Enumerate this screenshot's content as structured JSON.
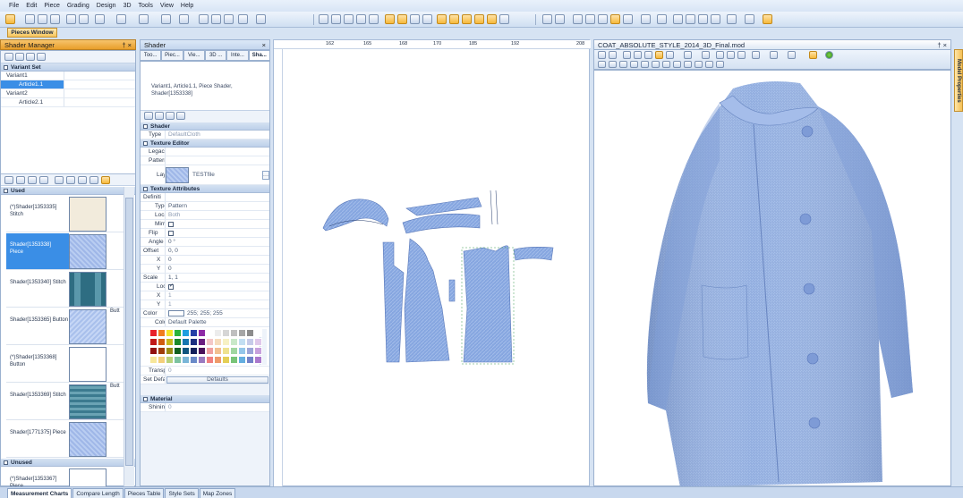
{
  "menu": [
    "File",
    "Edit",
    "Piece",
    "Grading",
    "Design",
    "3D",
    "Tools",
    "View",
    "Help"
  ],
  "pieces_window_label": "Pieces Window",
  "shader_manager": {
    "title": "Shader Manager",
    "pin": "†",
    "close": "×",
    "variant_set_label": "Variant Set",
    "variants": [
      {
        "label": "Variant1",
        "article": "Article1.1"
      },
      {
        "label": "Variant2",
        "article": "Article2.1"
      }
    ],
    "used_label": "Used",
    "unused_label": "Unused",
    "shaders": [
      {
        "label": "(*)Shader[1353335] Stitch",
        "swatch": "beige",
        "extra": ""
      },
      {
        "label": "Shader[1353338] Piece",
        "swatch": "blue",
        "extra": "",
        "selected": true
      },
      {
        "label": "Shader[1353340] Stitch",
        "swatch": "teal",
        "extra": ""
      },
      {
        "label": "Shader[1353365] Button",
        "swatch": "lblue",
        "extra": "Butt"
      },
      {
        "label": "(*)Shader[1353368] Button",
        "swatch": "white",
        "extra": ""
      },
      {
        "label": "Shader[1353369] Stitch",
        "swatch": "teal2",
        "extra": "Butt"
      },
      {
        "label": "Shader[1771375] Piece",
        "swatch": "blue",
        "extra": ""
      }
    ],
    "unused_shaders": [
      {
        "label": "(*)Shader[1353367] Piece",
        "swatch": "white"
      }
    ]
  },
  "shader_panel": {
    "title": "Shader",
    "tabs": [
      "Too...",
      "Piec...",
      "Vie...",
      "3D ...",
      "Inte...",
      "Sha..."
    ],
    "info_text": "Variant1, Article1.1, Piece Shader, Shader[1353338]",
    "groups": {
      "shader": "Shader",
      "texture_editor": "Texture Editor",
      "texture_attributes": "Texture Attributes",
      "material": "Material"
    },
    "type_label": "Type",
    "type_value": "DefaultCloth",
    "legacy_label": "Legac",
    "patterns_label": "Patterns",
    "layer_label": "Layer",
    "layer_value": "TESTfile",
    "definition_label": "Definiti",
    "def_type_label": "Type",
    "def_type_value": "Pattern",
    "local_label": "Local",
    "local_value": "Both",
    "mirror_label": "Mirr",
    "flip_label": "Flip",
    "angle_label": "Angle",
    "angle_value": "0 °",
    "offset_label": "Offset",
    "offset_value": "0, 0",
    "x_label": "X",
    "y_label": "Y",
    "x_value": "0",
    "y_value": "0",
    "scale_label": "Scale",
    "scale_value": "1, 1",
    "lock_label": "Lock",
    "sx_value": "1",
    "sy_value": "1",
    "color_label": "Color",
    "color_value": "255; 255; 255",
    "colors_label": "Color",
    "colors_value": "Default Palette",
    "transp_label": "Transpa",
    "transp_value": "0",
    "setdef_label": "Set Defa",
    "defaults_button": "Defaults",
    "shininess_label": "Shinine",
    "shininess_value": "0",
    "palette": [
      "#e8202a",
      "#f07d1f",
      "#f5e52a",
      "#2ab33a",
      "#1e9fe0",
      "#243fa6",
      "#8e2aa6",
      "#ffffff",
      "#ececec",
      "#d6d6d6",
      "#bfbfbf",
      "#a6a6a6",
      "#8c8c8c",
      "#ffffff",
      "#c01818",
      "#d05c12",
      "#c8b81c",
      "#1c8a2a",
      "#1676b0",
      "#1b2f80",
      "#6a1e80",
      "#f4c8c8",
      "#f6dcbc",
      "#f7f1c4",
      "#c8e8c8",
      "#c2def2",
      "#c6cbe9",
      "#dfc8ea",
      "#901010",
      "#a03e0a",
      "#9a8c12",
      "#106020",
      "#0f557f",
      "#121f5a",
      "#4a125a",
      "#f0a0a0",
      "#f2c090",
      "#eee28f",
      "#a0d6a0",
      "#94c6ea",
      "#9ca5d8",
      "#c7a0dc",
      "#f7e79a",
      "#f4cf7a",
      "#b8d27a",
      "#7cc2a0",
      "#7ab6d8",
      "#6a8ac8",
      "#9a7ac0",
      "#f08080",
      "#ee9a6a",
      "#e4cf56",
      "#78c478",
      "#64aee0",
      "#7282c8",
      "#aa78cc"
    ]
  },
  "canvas_ruler": [
    "162",
    "165",
    "168",
    "170",
    "185",
    "192",
    "208"
  ],
  "view3d": {
    "title": "COAT_ABSOLUTE_STYLE_2014_3D_Final.mod",
    "side_tab": "Model Properties"
  },
  "bottom_tabs": [
    "Measurement Charts",
    "Compare Length",
    "Pieces Table",
    "Style Sets",
    "Map Zones"
  ]
}
